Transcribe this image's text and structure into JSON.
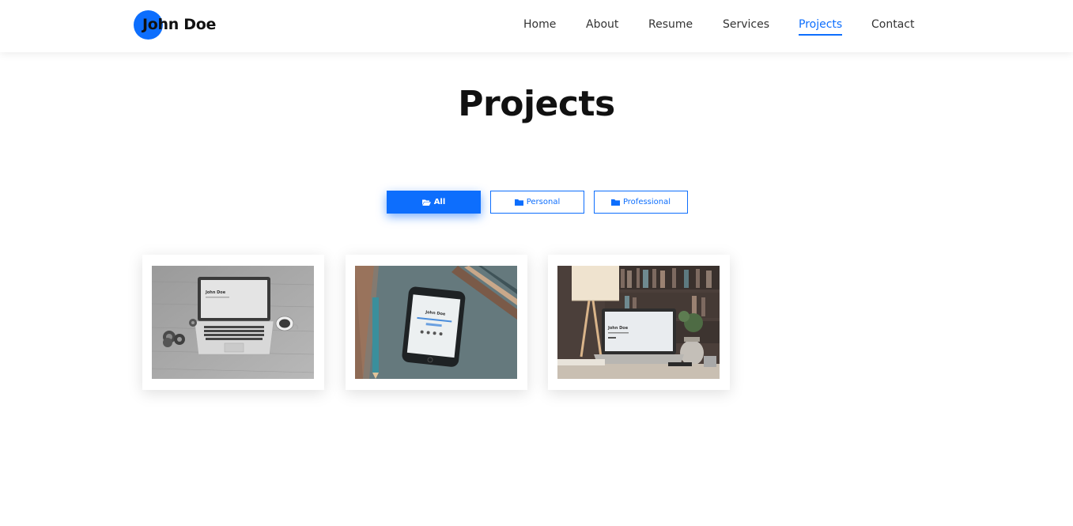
{
  "header": {
    "logo_initial": "J",
    "logo_text": "John Doe",
    "nav": [
      {
        "label": "Home",
        "active": false
      },
      {
        "label": "About",
        "active": false
      },
      {
        "label": "Resume",
        "active": false
      },
      {
        "label": "Services",
        "active": false
      },
      {
        "label": "Projects",
        "active": true
      },
      {
        "label": "Contact",
        "active": false
      }
    ]
  },
  "page": {
    "title": "Projects"
  },
  "filters": [
    {
      "label": "All",
      "icon": "folder-open-icon",
      "active": true
    },
    {
      "label": "Personal",
      "icon": "folder-icon",
      "active": false
    },
    {
      "label": "Professional",
      "icon": "folder-icon",
      "active": false
    }
  ],
  "projects": [
    {
      "image": "laptop-on-wooden-desk-grayscale",
      "screen_text": "John Doe"
    },
    {
      "image": "smartphone-on-desk-with-pencils",
      "screen_text": "John Doe"
    },
    {
      "image": "laptop-with-lamp-and-bookshelf",
      "screen_text": "John Doe"
    }
  ],
  "colors": {
    "accent": "#0d6efd",
    "text": "#111111",
    "nav_text": "#333333",
    "background": "#ffffff"
  }
}
